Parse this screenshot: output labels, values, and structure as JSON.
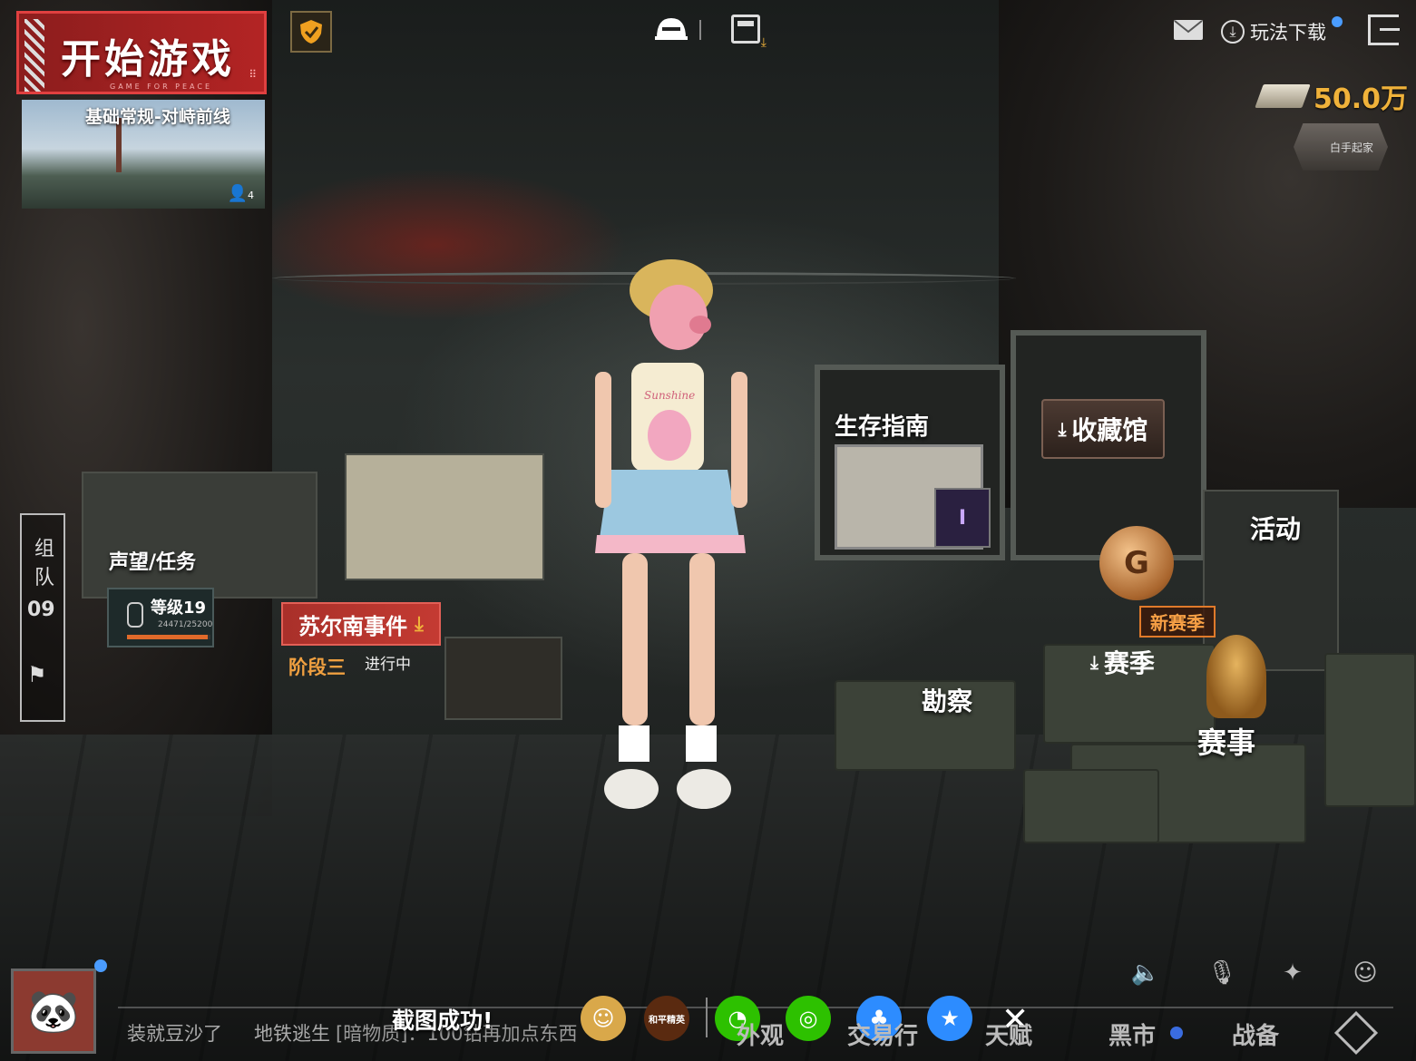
{
  "top_left": {
    "start_game": "开始游戏",
    "start_subtitle": "GAME FOR PEACE",
    "mode": "基础常规-对峙前线",
    "team_size": "4"
  },
  "top_right": {
    "download_play": "玩法下载",
    "coins": "50.0万",
    "badge": "白手起家"
  },
  "team": {
    "label": "组队",
    "number": "09"
  },
  "scene_buttons": {
    "reputation_task": "声望/任务",
    "level": "等级19",
    "level_xp": "24471/25200",
    "level_progress": 0.97,
    "event": "苏尔南事件",
    "event_stage": "阶段三",
    "event_status": "进行中",
    "survival_guide": "生存指南",
    "rank_badge": "I",
    "collection": "收藏馆",
    "activity": "活动",
    "new_season": "新赛季",
    "season": "赛季",
    "recon": "勘察",
    "match": "赛事",
    "season_trophy_letter": "G"
  },
  "character": {
    "shirt_text": "Sunshine"
  },
  "bottom": {
    "chat_1": "装就豆沙了",
    "chat_2": "地铁逃生",
    "chat_3": "[暗物质]：100钻再加点东西",
    "screenshot_toast": "截图成功!",
    "share_game_logo": "和平精英",
    "nav_appearance": "外观",
    "nav_trade": "交易行",
    "nav_talent": "天赋",
    "nav_market": "黑市",
    "nav_gear": "战备"
  },
  "colors": {
    "start_red": "#b32424",
    "coin_gold": "#f0b23a",
    "season_orange": "#f7a045",
    "wechat_green": "#2dc100",
    "qq_blue": "#2d8cff"
  }
}
